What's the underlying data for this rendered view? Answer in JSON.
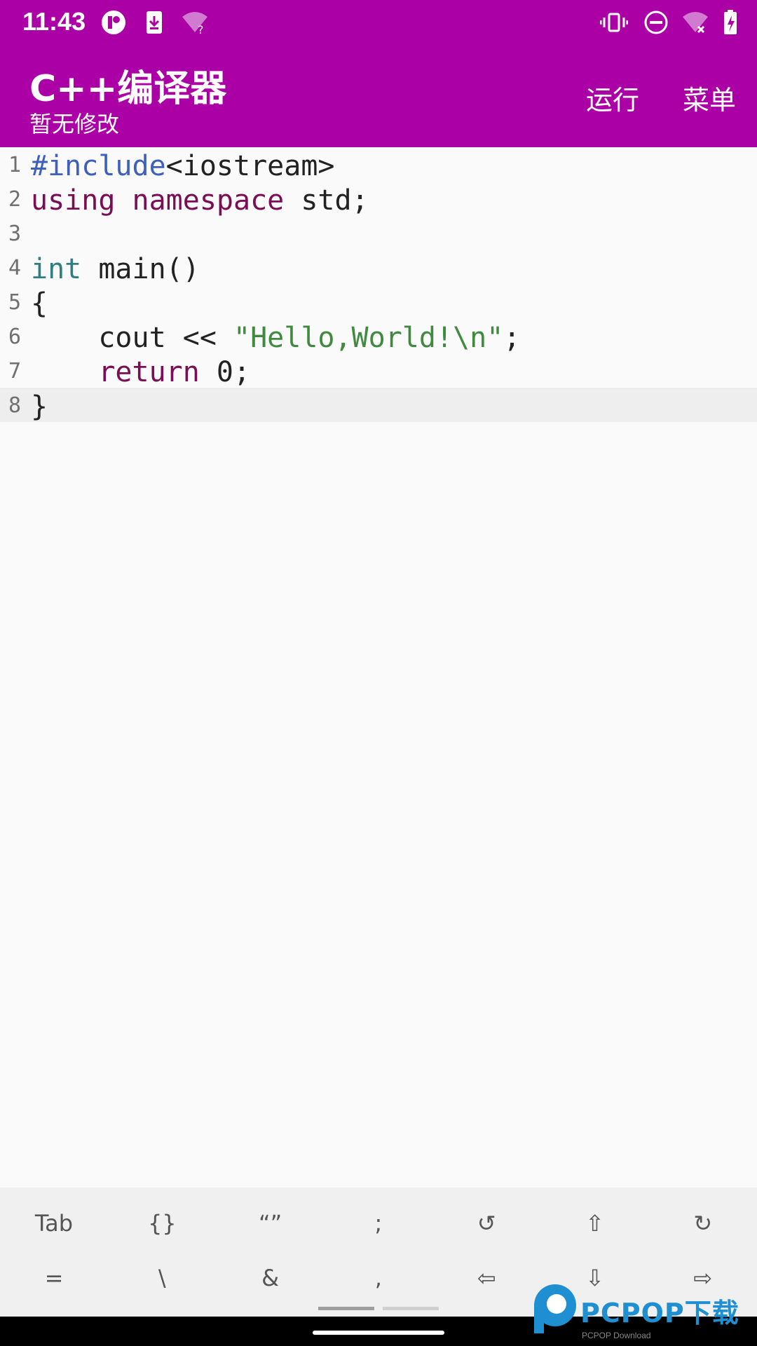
{
  "status_bar": {
    "time": "11:43",
    "left_icons": [
      "app-circle-icon",
      "download-icon",
      "wifi-question-icon"
    ],
    "right_icons": [
      "vibrate-icon",
      "do-not-disturb-icon",
      "wifi-off-icon",
      "battery-charging-icon"
    ]
  },
  "app_bar": {
    "title": "C++编译器",
    "subtitle": "暂无修改",
    "actions": {
      "run": "运行",
      "menu": "菜单"
    },
    "color": "#ab00a6"
  },
  "editor": {
    "lines": [
      {
        "num": "1",
        "segments": [
          {
            "t": "#include",
            "c": "kw-pre"
          },
          {
            "t": "<iostream>",
            "c": ""
          }
        ]
      },
      {
        "num": "2",
        "segments": [
          {
            "t": "using",
            "c": "kw"
          },
          {
            "t": " ",
            "c": ""
          },
          {
            "t": "namespace",
            "c": "kw"
          },
          {
            "t": " std;",
            "c": ""
          }
        ]
      },
      {
        "num": "3",
        "segments": []
      },
      {
        "num": "4",
        "segments": [
          {
            "t": "int",
            "c": "kw-type"
          },
          {
            "t": " main()",
            "c": ""
          }
        ]
      },
      {
        "num": "5",
        "segments": [
          {
            "t": "{",
            "c": ""
          }
        ]
      },
      {
        "num": "6",
        "segments": [
          {
            "t": "    cout << ",
            "c": ""
          },
          {
            "t": "\"Hello,World!\\n\"",
            "c": "str"
          },
          {
            "t": ";",
            "c": ""
          }
        ]
      },
      {
        "num": "7",
        "segments": [
          {
            "t": "    ",
            "c": ""
          },
          {
            "t": "return",
            "c": "kw"
          },
          {
            "t": " 0;",
            "c": ""
          }
        ]
      },
      {
        "num": "8",
        "segments": [
          {
            "t": "}",
            "c": ""
          }
        ]
      }
    ],
    "active_line": 8
  },
  "symbol_bar": {
    "row1": [
      "Tab",
      "{}",
      "“”",
      ";",
      "↺",
      "⇧",
      "↻"
    ],
    "row2": [
      "=",
      "\\",
      "&",
      ",",
      "⇦",
      "⇩",
      "⇨"
    ]
  },
  "watermark": {
    "text": "PCPOP下载",
    "sub": "PCPOP Download"
  }
}
